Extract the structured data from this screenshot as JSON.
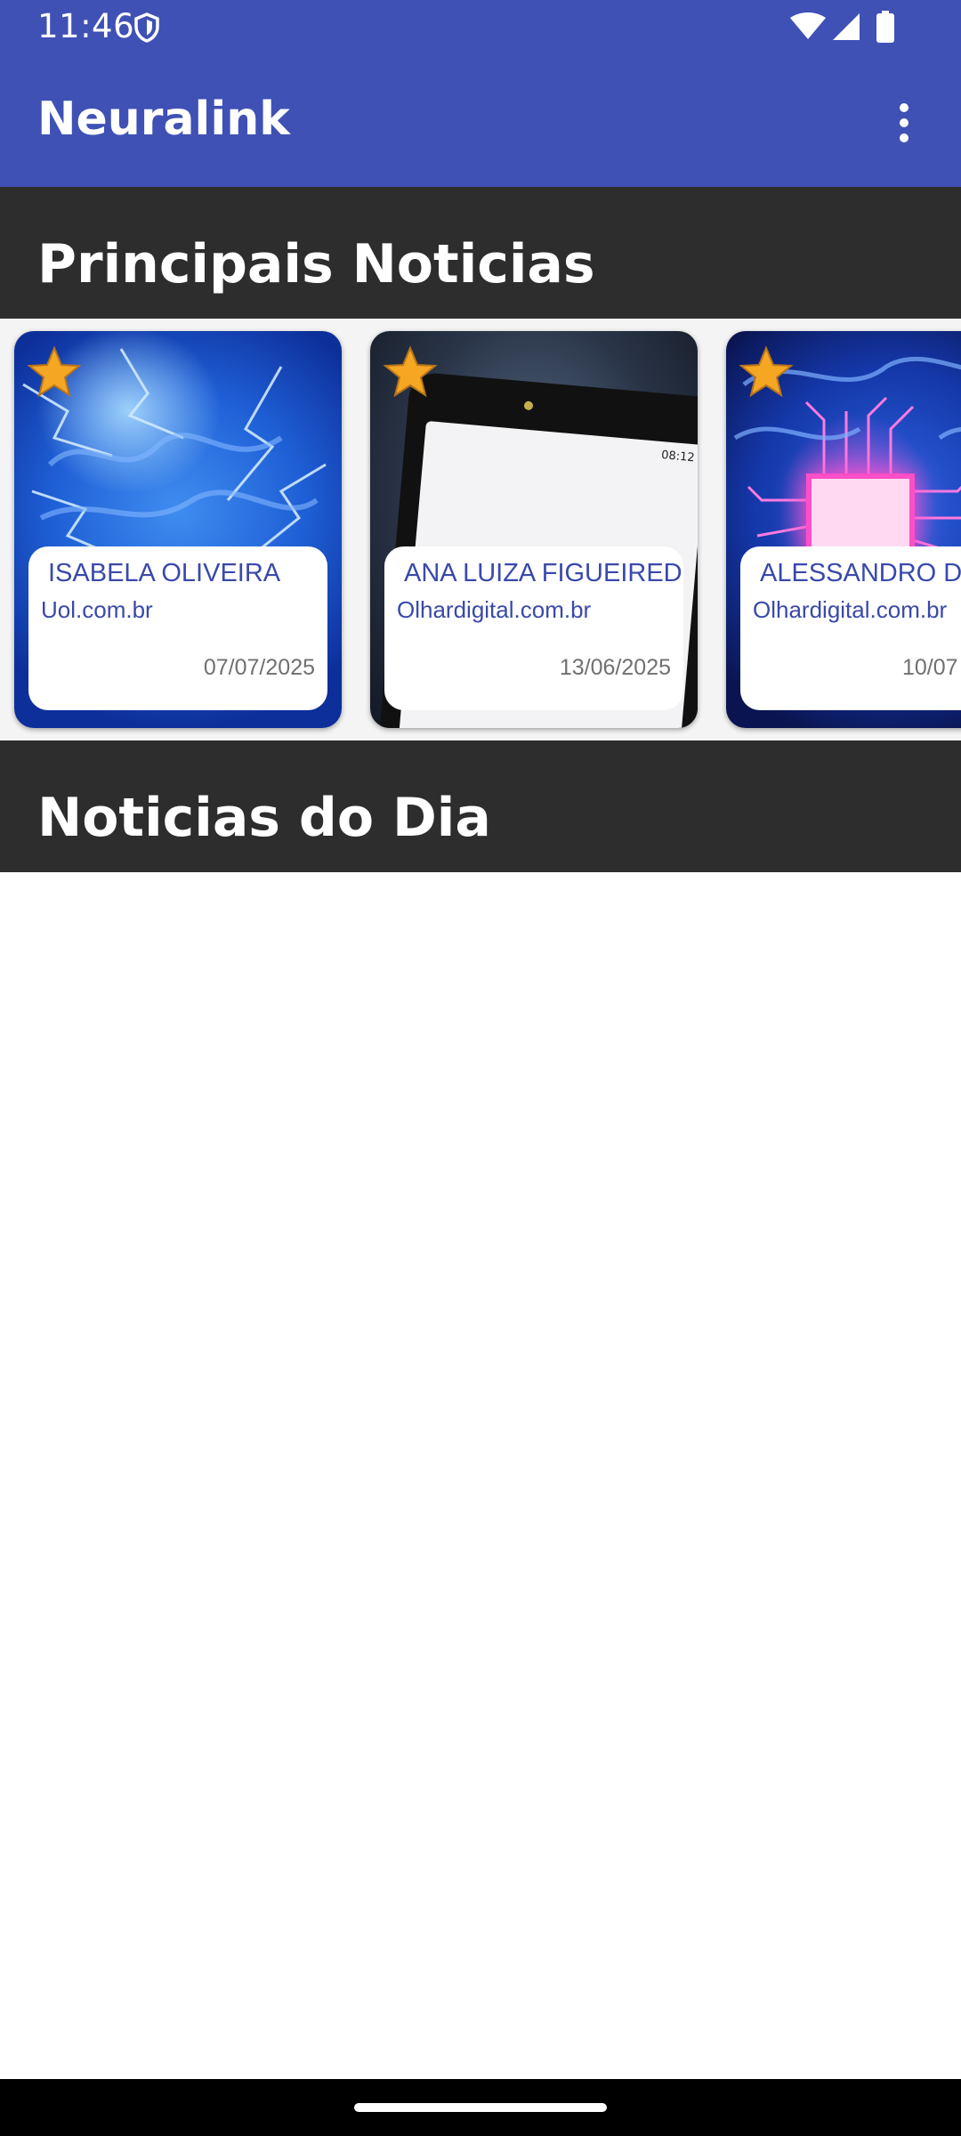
{
  "status_bar": {
    "time": "11:46",
    "icons": [
      "shield-icon",
      "wifi-icon",
      "signal-icon",
      "battery-icon"
    ]
  },
  "app_bar": {
    "title": "Neuralink",
    "menu_icon": "more-vert-icon"
  },
  "sections": {
    "top_news": {
      "title": "Principais Noticias"
    },
    "day_news": {
      "title": "Noticias do Dia"
    }
  },
  "top_news_cards": [
    {
      "author": " ISABELA OLIVEIRA",
      "source": "Uol.com.br",
      "date": "07/07/2025",
      "image": "brain-lightning-image",
      "starred": true
    },
    {
      "author": " ANA LUIZA FIGUEIREDO",
      "source": "Olhardigital.com.br",
      "date": "13/06/2025",
      "image": "smartphone-image",
      "starred": true
    },
    {
      "author": " ALESSANDRO DI",
      "source": "Olhardigital.com.br",
      "date": "10/07",
      "image": "brain-chip-image",
      "starred": true
    }
  ],
  "colors": {
    "app_bar": "#3f51b5",
    "section_header": "#2d2d2d",
    "card_text_accent": "#3949ab",
    "date_text": "#707070",
    "star": "#f5a623"
  }
}
